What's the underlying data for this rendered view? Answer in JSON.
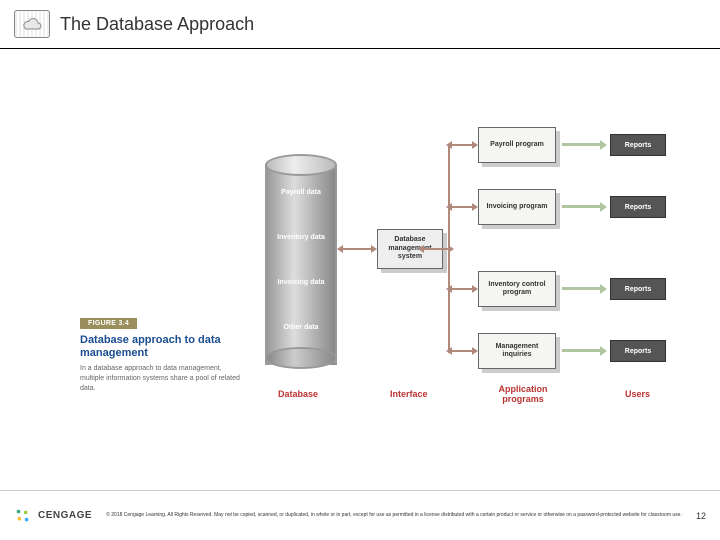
{
  "header": {
    "title": "The Database Approach"
  },
  "figure": {
    "badge": "FIGURE 3.4",
    "title": "Database approach to data management",
    "body": "In a database approach to data management, multiple information systems share a pool of related data."
  },
  "db": {
    "segs": [
      "Payroll data",
      "Inventory data",
      "Invoicing data",
      "Other data"
    ]
  },
  "dbms": {
    "label": "Database management system"
  },
  "apps": [
    "Payroll program",
    "Invoicing program",
    "Inventory control program",
    "Management inquiries"
  ],
  "users": [
    "Reports",
    "Reports",
    "Reports",
    "Reports"
  ],
  "cols": {
    "db": "Database",
    "iface": "Interface",
    "apps": "Application programs",
    "users": "Users"
  },
  "footer": {
    "brand": "CENGAGE",
    "copyright": "© 2018 Cengage Learning. All Rights Reserved. May not be copied, scanned, or duplicated, in whole or in part, except for use as permitted in a license distributed with a certain product or service or otherwise on a password-protected website for classroom use.",
    "page": "12"
  }
}
